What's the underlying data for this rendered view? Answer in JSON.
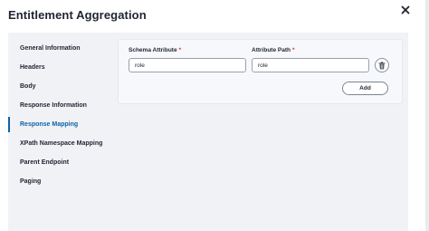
{
  "modal": {
    "title": "Entitlement Aggregation"
  },
  "nav": {
    "items": [
      {
        "label": "General Information",
        "active": false
      },
      {
        "label": "Headers",
        "active": false
      },
      {
        "label": "Body",
        "active": false
      },
      {
        "label": "Response Information",
        "active": false
      },
      {
        "label": "Response Mapping",
        "active": true
      },
      {
        "label": "XPath Namespace Mapping",
        "active": false
      },
      {
        "label": "Parent Endpoint",
        "active": false
      },
      {
        "label": "Paging",
        "active": false
      }
    ]
  },
  "mapping": {
    "schema_attribute_label": "Schema Attribute",
    "attribute_path_label": "Attribute Path",
    "required_marker": "*",
    "rows": [
      {
        "schema_attribute": "role",
        "attribute_path": "role"
      }
    ],
    "add_label": "Add"
  },
  "colors": {
    "accent": "#0b62a8",
    "required": "#d0342c",
    "content_bg": "#f1f2f6"
  },
  "icons": {
    "close": "close-icon",
    "delete": "trash-icon"
  }
}
